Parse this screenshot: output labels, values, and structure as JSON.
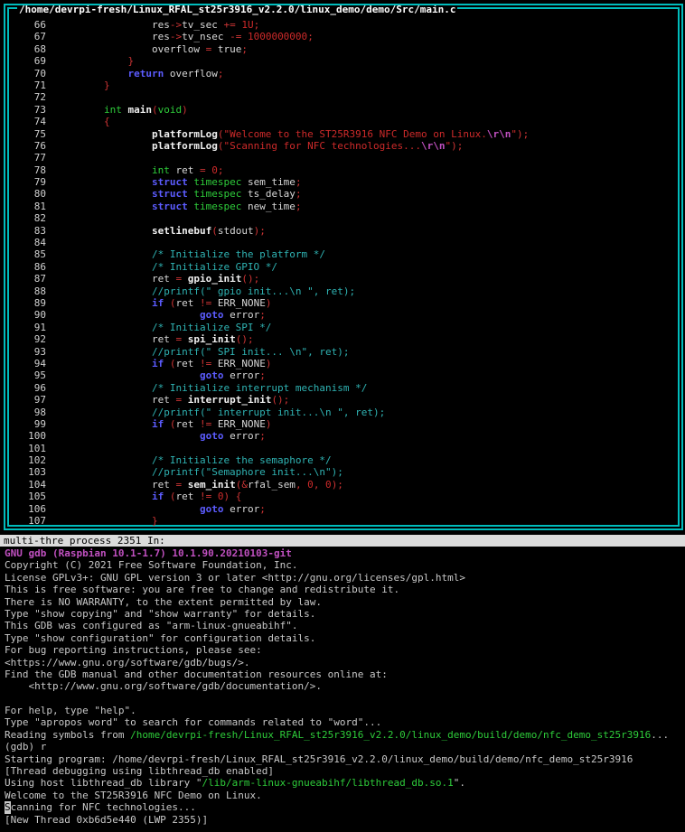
{
  "source_window": {
    "title": "/home/devrpi-fresh/Linux_RFAL_st25r3916_v2.2.0/linux_demo/demo/Src/main.c",
    "lines": [
      {
        "n": "66",
        "indent": 4,
        "tokens": [
          [
            "id",
            "res"
          ],
          [
            "op",
            "->"
          ],
          [
            "id",
            "tv_sec "
          ],
          [
            "op",
            "+="
          ],
          [
            "num",
            " 1U"
          ],
          [
            "op",
            ";"
          ]
        ]
      },
      {
        "n": "67",
        "indent": 4,
        "tokens": [
          [
            "id",
            "res"
          ],
          [
            "op",
            "->"
          ],
          [
            "id",
            "tv_nsec "
          ],
          [
            "op",
            "-="
          ],
          [
            "num",
            " 1000000000"
          ],
          [
            "op",
            ";"
          ]
        ]
      },
      {
        "n": "68",
        "indent": 4,
        "tokens": [
          [
            "id",
            "overflow "
          ],
          [
            "op",
            "="
          ],
          [
            "id",
            " true"
          ],
          [
            "op",
            ";"
          ]
        ]
      },
      {
        "n": "69",
        "indent": 3,
        "tokens": [
          [
            "op",
            "}"
          ]
        ]
      },
      {
        "n": "70",
        "indent": 3,
        "tokens": [
          [
            "kw",
            "return"
          ],
          [
            "id",
            " overflow"
          ],
          [
            "op",
            ";"
          ]
        ]
      },
      {
        "n": "71",
        "indent": 2,
        "tokens": [
          [
            "op",
            "}"
          ]
        ]
      },
      {
        "n": "72",
        "indent": 0,
        "tokens": []
      },
      {
        "n": "73",
        "indent": 2,
        "tokens": [
          [
            "type",
            "int"
          ],
          [
            "id",
            " "
          ],
          [
            "fn",
            "main"
          ],
          [
            "op",
            "("
          ],
          [
            "type",
            "void"
          ],
          [
            "op",
            ")"
          ]
        ]
      },
      {
        "n": "74",
        "indent": 2,
        "tokens": [
          [
            "op",
            "{"
          ]
        ]
      },
      {
        "n": "75",
        "indent": 4,
        "tokens": [
          [
            "fn",
            "platformLog"
          ],
          [
            "op",
            "("
          ],
          [
            "str",
            "\"Welcome to the ST25R3916 NFC Demo on Linux."
          ],
          [
            "esc",
            "\\r\\n"
          ],
          [
            "str",
            "\""
          ],
          [
            "op",
            ");"
          ]
        ]
      },
      {
        "n": "76",
        "indent": 4,
        "tokens": [
          [
            "fn",
            "platformLog"
          ],
          [
            "op",
            "("
          ],
          [
            "str",
            "\"Scanning for NFC technologies..."
          ],
          [
            "esc",
            "\\r\\n"
          ],
          [
            "str",
            "\""
          ],
          [
            "op",
            ");"
          ]
        ]
      },
      {
        "n": "77",
        "indent": 0,
        "tokens": []
      },
      {
        "n": "78",
        "indent": 4,
        "tokens": [
          [
            "type",
            "int"
          ],
          [
            "id",
            " ret "
          ],
          [
            "op",
            "="
          ],
          [
            "num",
            " 0"
          ],
          [
            "op",
            ";"
          ]
        ]
      },
      {
        "n": "79",
        "indent": 4,
        "tokens": [
          [
            "kw",
            "struct"
          ],
          [
            "type",
            " timespec"
          ],
          [
            "id",
            " sem_time"
          ],
          [
            "op",
            ";"
          ]
        ]
      },
      {
        "n": "80",
        "indent": 4,
        "tokens": [
          [
            "kw",
            "struct"
          ],
          [
            "type",
            " timespec"
          ],
          [
            "id",
            " ts_delay"
          ],
          [
            "op",
            ";"
          ]
        ]
      },
      {
        "n": "81",
        "indent": 4,
        "tokens": [
          [
            "kw",
            "struct"
          ],
          [
            "type",
            " timespec"
          ],
          [
            "id",
            " new_time"
          ],
          [
            "op",
            ";"
          ]
        ]
      },
      {
        "n": "82",
        "indent": 0,
        "tokens": []
      },
      {
        "n": "83",
        "indent": 4,
        "tokens": [
          [
            "fn",
            "setlinebuf"
          ],
          [
            "op",
            "("
          ],
          [
            "id",
            "stdout"
          ],
          [
            "op",
            ");"
          ]
        ]
      },
      {
        "n": "84",
        "indent": 0,
        "tokens": []
      },
      {
        "n": "85",
        "indent": 4,
        "tokens": [
          [
            "cmt",
            "/* Initialize the platform */"
          ]
        ]
      },
      {
        "n": "86",
        "indent": 4,
        "tokens": [
          [
            "cmt",
            "/* Initialize GPIO */"
          ]
        ]
      },
      {
        "n": "87",
        "indent": 4,
        "tokens": [
          [
            "id",
            "ret "
          ],
          [
            "op",
            "="
          ],
          [
            "id",
            " "
          ],
          [
            "fn",
            "gpio_init"
          ],
          [
            "op",
            "();"
          ]
        ]
      },
      {
        "n": "88",
        "indent": 4,
        "tokens": [
          [
            "cmt",
            "//printf(\" gpio init...\\n \", ret);"
          ]
        ]
      },
      {
        "n": "89",
        "indent": 4,
        "tokens": [
          [
            "kw",
            "if"
          ],
          [
            "id",
            " "
          ],
          [
            "op",
            "("
          ],
          [
            "id",
            "ret "
          ],
          [
            "op",
            "!="
          ],
          [
            "id",
            " ERR_NONE"
          ],
          [
            "op",
            ")"
          ]
        ]
      },
      {
        "n": "90",
        "indent": 6,
        "tokens": [
          [
            "kw",
            "goto"
          ],
          [
            "id",
            " error"
          ],
          [
            "op",
            ";"
          ]
        ]
      },
      {
        "n": "91",
        "indent": 4,
        "tokens": [
          [
            "cmt",
            "/* Initialize SPI */"
          ]
        ]
      },
      {
        "n": "92",
        "indent": 4,
        "tokens": [
          [
            "id",
            "ret "
          ],
          [
            "op",
            "="
          ],
          [
            "id",
            " "
          ],
          [
            "fn",
            "spi_init"
          ],
          [
            "op",
            "();"
          ]
        ]
      },
      {
        "n": "93",
        "indent": 4,
        "tokens": [
          [
            "cmt",
            "//printf(\" SPI init... \\n\", ret);"
          ]
        ]
      },
      {
        "n": "94",
        "indent": 4,
        "tokens": [
          [
            "kw",
            "if"
          ],
          [
            "id",
            " "
          ],
          [
            "op",
            "("
          ],
          [
            "id",
            "ret "
          ],
          [
            "op",
            "!="
          ],
          [
            "id",
            " ERR_NONE"
          ],
          [
            "op",
            ")"
          ]
        ]
      },
      {
        "n": "95",
        "indent": 6,
        "tokens": [
          [
            "kw",
            "goto"
          ],
          [
            "id",
            " error"
          ],
          [
            "op",
            ";"
          ]
        ]
      },
      {
        "n": "96",
        "indent": 4,
        "tokens": [
          [
            "cmt",
            "/* Initialize interrupt mechanism */"
          ]
        ]
      },
      {
        "n": "97",
        "indent": 4,
        "tokens": [
          [
            "id",
            "ret "
          ],
          [
            "op",
            "="
          ],
          [
            "id",
            " "
          ],
          [
            "fn",
            "interrupt_init"
          ],
          [
            "op",
            "();"
          ]
        ]
      },
      {
        "n": "98",
        "indent": 4,
        "tokens": [
          [
            "cmt",
            "//printf(\" interrupt init...\\n \", ret);"
          ]
        ]
      },
      {
        "n": "99",
        "indent": 4,
        "tokens": [
          [
            "kw",
            "if"
          ],
          [
            "id",
            " "
          ],
          [
            "op",
            "("
          ],
          [
            "id",
            "ret "
          ],
          [
            "op",
            "!="
          ],
          [
            "id",
            " ERR_NONE"
          ],
          [
            "op",
            ")"
          ]
        ]
      },
      {
        "n": "100",
        "indent": 6,
        "tokens": [
          [
            "kw",
            "goto"
          ],
          [
            "id",
            " error"
          ],
          [
            "op",
            ";"
          ]
        ]
      },
      {
        "n": "101",
        "indent": 0,
        "tokens": []
      },
      {
        "n": "102",
        "indent": 4,
        "tokens": [
          [
            "cmt",
            "/* Initialize the semaphore */"
          ]
        ]
      },
      {
        "n": "103",
        "indent": 4,
        "tokens": [
          [
            "cmt",
            "//printf(\"Semaphore init...\\n\");"
          ]
        ]
      },
      {
        "n": "104",
        "indent": 4,
        "tokens": [
          [
            "id",
            "ret "
          ],
          [
            "op",
            "="
          ],
          [
            "id",
            " "
          ],
          [
            "fn",
            "sem_init"
          ],
          [
            "op",
            "(&"
          ],
          [
            "id",
            "rfal_sem"
          ],
          [
            "op",
            ","
          ],
          [
            "num",
            " 0"
          ],
          [
            "op",
            ","
          ],
          [
            "num",
            " 0"
          ],
          [
            "op",
            ");"
          ]
        ]
      },
      {
        "n": "105",
        "indent": 4,
        "tokens": [
          [
            "kw",
            "if"
          ],
          [
            "id",
            " "
          ],
          [
            "op",
            "("
          ],
          [
            "id",
            "ret "
          ],
          [
            "op",
            "!="
          ],
          [
            "num",
            " 0"
          ],
          [
            "op",
            ") {"
          ]
        ]
      },
      {
        "n": "106",
        "indent": 6,
        "tokens": [
          [
            "kw",
            "goto"
          ],
          [
            "id",
            " error"
          ],
          [
            "op",
            ";"
          ]
        ]
      },
      {
        "n": "107",
        "indent": 4,
        "tokens": [
          [
            "op",
            "}"
          ]
        ]
      }
    ]
  },
  "status_bar": {
    "text": "multi-thre process 2351 In:"
  },
  "console": {
    "lines": [
      {
        "cls": "head",
        "text": "GNU gdb (Raspbian 10.1-1.7) 10.1.90.20210103-git"
      },
      {
        "text": "Copyright (C) 2021 Free Software Foundation, Inc."
      },
      {
        "text": "License GPLv3+: GNU GPL version 3 or later <http://gnu.org/licenses/gpl.html>"
      },
      {
        "text": "This is free software: you are free to change and redistribute it."
      },
      {
        "text": "There is NO WARRANTY, to the extent permitted by law."
      },
      {
        "text": "Type \"show copying\" and \"show warranty\" for details."
      },
      {
        "text": "This GDB was configured as \"arm-linux-gnueabihf\"."
      },
      {
        "text": "Type \"show configuration\" for configuration details."
      },
      {
        "text": "For bug reporting instructions, please see:"
      },
      {
        "text": "<https://www.gnu.org/software/gdb/bugs/>."
      },
      {
        "text": "Find the GDB manual and other documentation resources online at:"
      },
      {
        "text": "    <http://www.gnu.org/software/gdb/documentation/>."
      },
      {
        "text": ""
      },
      {
        "text": "For help, type \"help\"."
      },
      {
        "text": "Type \"apropos word\" to search for commands related to \"word\"..."
      },
      {
        "pre": "Reading symbols from ",
        "path": "/home/devrpi-fresh/Linux_RFAL_st25r3916_v2.2.0/linux_demo/build/demo/nfc_demo_st25r3916",
        "post": "..."
      },
      {
        "text": "(gdb) r"
      },
      {
        "text": "Starting program: /home/devrpi-fresh/Linux_RFAL_st25r3916_v2.2.0/linux_demo/build/demo/nfc_demo_st25r3916"
      },
      {
        "text": "[Thread debugging using libthread_db enabled]"
      },
      {
        "pre": "Using host libthread_db library \"",
        "path": "/lib/arm-linux-gnueabihf/libthread_db.so.1",
        "post": "\"."
      },
      {
        "text": "Welcome to the ST25R3916 NFC Demo on Linux."
      },
      {
        "cursor": "S",
        "text": "canning for NFC technologies..."
      },
      {
        "text": "[New Thread 0xb6d5e440 (LWP 2355)]"
      }
    ]
  }
}
